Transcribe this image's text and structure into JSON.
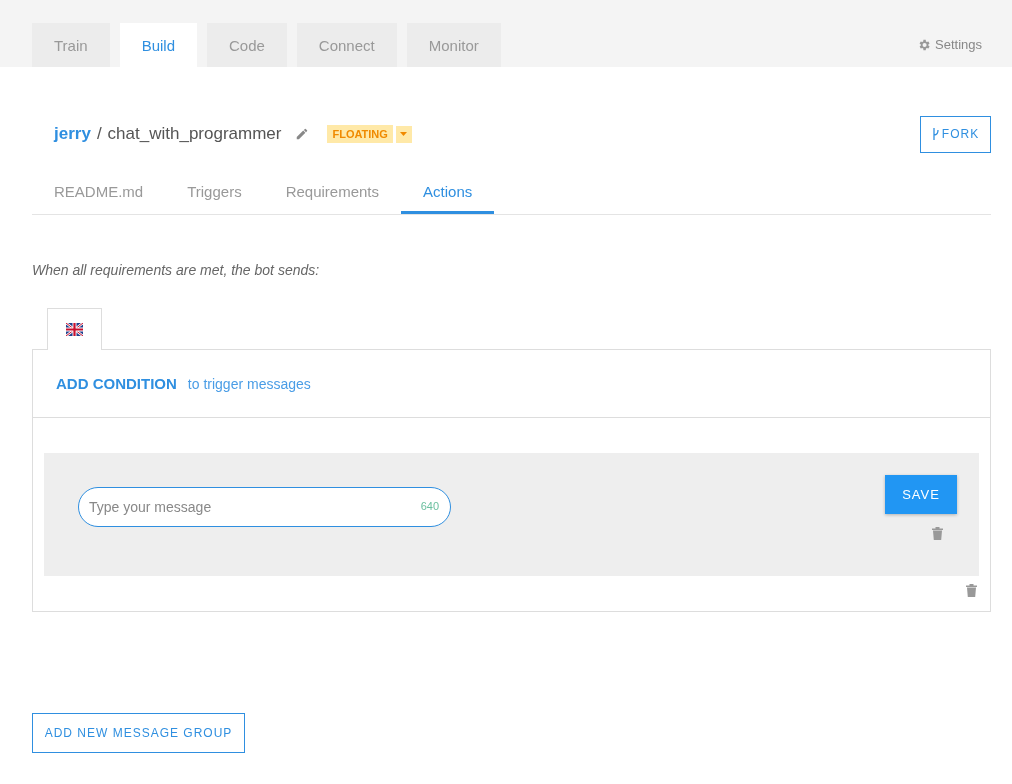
{
  "top_tabs": [
    {
      "label": "Train",
      "selected": false
    },
    {
      "label": "Build",
      "selected": true
    },
    {
      "label": "Code",
      "selected": false
    },
    {
      "label": "Connect",
      "selected": false
    },
    {
      "label": "Monitor",
      "selected": false
    }
  ],
  "settings": {
    "label": "Settings"
  },
  "project": {
    "owner": "jerry",
    "separator": "/",
    "name": "chat_with_programmer",
    "status": "FLOATING"
  },
  "fork_button": {
    "label": "FORK"
  },
  "sub_tabs": [
    {
      "label": "README.md",
      "selected": false
    },
    {
      "label": "Triggers",
      "selected": false
    },
    {
      "label": "Requirements",
      "selected": false
    },
    {
      "label": "Actions",
      "selected": true
    }
  ],
  "intro": "When all requirements are met, the bot sends:",
  "condition": {
    "action": "ADD CONDITION",
    "hint": "to trigger messages"
  },
  "message": {
    "placeholder": "Type your message",
    "counter": "640",
    "save": "SAVE"
  },
  "add_group_button": "ADD NEW MESSAGE GROUP"
}
